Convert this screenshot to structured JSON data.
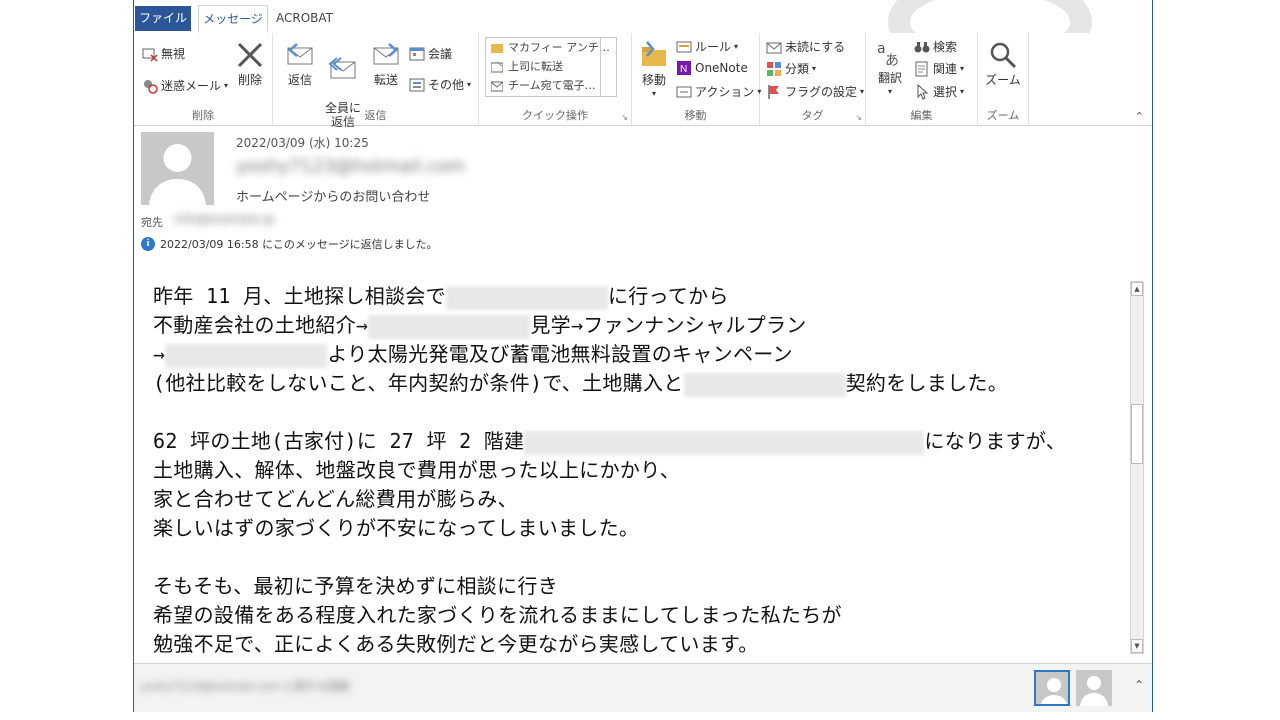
{
  "tabs": {
    "file": "ファイル",
    "message": "メッセージ",
    "acrobat": "ACROBAT"
  },
  "ribbon": {
    "delete_group": {
      "ignore": "無視",
      "junk": "迷惑メール",
      "delete": "削除",
      "label": "削除"
    },
    "reply_group": {
      "reply": "返信",
      "reply_all": "全員に\n返信",
      "forward": "転送",
      "meeting": "会議",
      "more": "その他",
      "label": "返信"
    },
    "quick_steps": {
      "items": [
        "マカフィー アンチ…",
        "上司に転送",
        "チーム宛て電子…"
      ],
      "label": "クイック操作"
    },
    "move_group": {
      "move": "移動",
      "rules": "ルール",
      "onenote": "OneNote",
      "actions": "アクション",
      "label": "移動"
    },
    "tags_group": {
      "unread": "未読にする",
      "categorize": "分類",
      "flag": "フラグの設定",
      "label": "タグ"
    },
    "edit_group": {
      "translate": "翻訳",
      "find": "検索",
      "related": "関連",
      "select": "選択",
      "label": "編集"
    },
    "zoom_group": {
      "zoom": "ズーム",
      "label": "ズーム"
    }
  },
  "header": {
    "date": "2022/03/09 (水) 10:25",
    "sender": "yoshy7123@hotmail.com",
    "subject": "ホームページからのお問い合わせ",
    "to_label": "宛先",
    "to_value": "info@example.jp",
    "info_text": "2022/03/09 16:58 にこのメッセージに返信しました。"
  },
  "body": {
    "p1": [
      [
        "昨年 11 月、土地探し相談会で",
        "に行ってから"
      ],
      [
        "不動産会社の土地紹介→",
        "見学→ファンナンシャルプラン"
      ],
      [
        "→",
        "より太陽光発電及び蓄電池無料設置のキャンペーン"
      ],
      [
        "(他社比較をしないこと、年内契約が条件)で、土地購入と",
        "契約をしました。"
      ]
    ],
    "p2": [
      [
        "62 坪の土地(古家付)に 27 坪 2 階建",
        "になりますが、"
      ],
      [
        "土地購入、解体、地盤改良で費用が思った以上にかかり、",
        ""
      ],
      [
        "家と合わせてどんどん総費用が膨らみ、",
        ""
      ],
      [
        "楽しいはずの家づくりが不安になってしまいました。",
        ""
      ]
    ],
    "p3": [
      [
        "そもそも、最初に予算を決めずに相談に行き",
        ""
      ],
      [
        "希望の設備をある程度入れた家づくりを流れるままにしてしまった私たちが",
        ""
      ],
      [
        "勉強不足で、正によくある失敗例だと今更ながら実感しています。",
        ""
      ]
    ]
  },
  "footer": {
    "people_text": "yoshy7123@hotmail.com に関する情報"
  },
  "colors": {
    "accent": "#2b579a",
    "info": "#2b79c8"
  }
}
